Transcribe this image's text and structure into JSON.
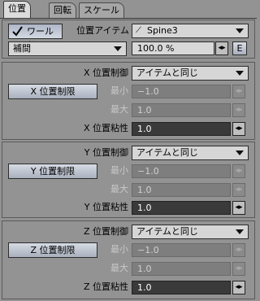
{
  "tabs": [
    "位置",
    "回転",
    "スケール"
  ],
  "top": {
    "world_label": "ワールド",
    "world_checked": true,
    "pos_item_label": "位置アイテム",
    "pos_item_value": "Spine3",
    "interp_value": "補間",
    "percent_value": "100.0 %",
    "spin_glyph": "◂▸",
    "e_label": "E"
  },
  "axes": [
    {
      "ctrl_label": "X 位置制御",
      "ctrl_value": "アイテムと同じ",
      "limit_label": "X 位置制限",
      "min_label": "最小",
      "min_value": "−1.0",
      "max_label": "最大",
      "max_value": "1.0",
      "visc_label": "X 位置粘性",
      "visc_value": "1.0"
    },
    {
      "ctrl_label": "Y 位置制御",
      "ctrl_value": "アイテムと同じ",
      "limit_label": "Y 位置制限",
      "min_label": "最小",
      "min_value": "−1.0",
      "max_label": "最大",
      "max_value": "1.0",
      "visc_label": "Y 位置粘性",
      "visc_value": "1.0"
    },
    {
      "ctrl_label": "Z 位置制御",
      "ctrl_value": "アイテムと同じ",
      "limit_label": "Z 位置制限",
      "min_label": "最小",
      "min_value": "−1.0",
      "max_label": "最大",
      "max_value": "1.0",
      "visc_label": "Z 位置粘性",
      "visc_value": "1.0"
    }
  ]
}
